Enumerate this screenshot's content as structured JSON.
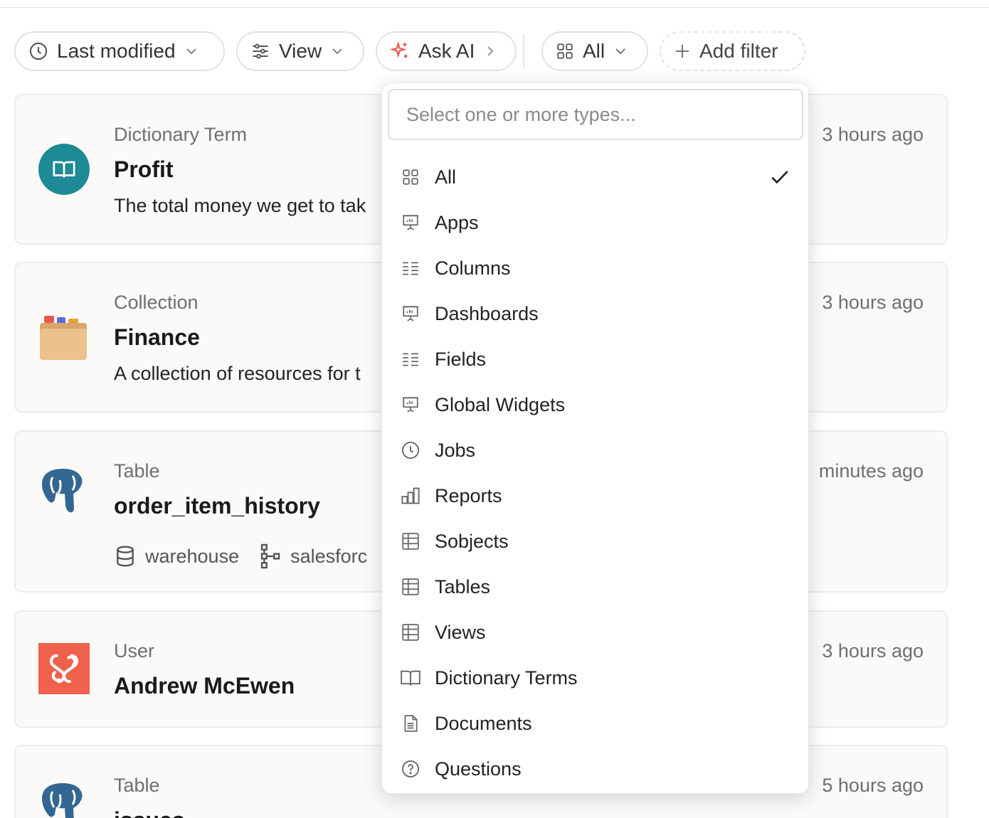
{
  "toolbar": {
    "sort_label": "Last modified",
    "view_label": "View",
    "ask_ai_label": "Ask AI",
    "type_label": "All",
    "add_filter_label": "Add filter"
  },
  "colors": {
    "ai_accent": "#e9574a",
    "dictionary_avatar": "#1e8a96",
    "user_avatar": "#f0614b",
    "postgres_blue": "#336791"
  },
  "results": [
    {
      "type": "Dictionary Term",
      "title": "Profit",
      "description": "The total money we get to tak",
      "time": "3 hours ago",
      "icon": "book-icon"
    },
    {
      "type": "Collection",
      "title": "Finance",
      "description": "A collection of resources for t",
      "time": "3 hours ago",
      "icon": "folder-icon"
    },
    {
      "type": "Table",
      "title": "order_item_history",
      "time": "minutes ago",
      "icon": "postgres-elephant-icon",
      "meta": [
        {
          "icon": "database-icon",
          "label": "warehouse"
        },
        {
          "icon": "schema-icon",
          "label": "salesforc"
        }
      ]
    },
    {
      "type": "User",
      "title": "Andrew McEwen",
      "time": "3 hours ago",
      "icon": "user-logo-icon"
    },
    {
      "type": "Table",
      "title": "issues",
      "time": "5 hours ago",
      "icon": "postgres-elephant-icon"
    }
  ],
  "type_filter": {
    "placeholder": "Select one or more types...",
    "options": [
      {
        "label": "All",
        "icon": "grid-icon",
        "selected": true
      },
      {
        "label": "Apps",
        "icon": "presentation-icon"
      },
      {
        "label": "Columns",
        "icon": "list-icon"
      },
      {
        "label": "Dashboards",
        "icon": "presentation-icon"
      },
      {
        "label": "Fields",
        "icon": "list-icon"
      },
      {
        "label": "Global Widgets",
        "icon": "presentation-icon"
      },
      {
        "label": "Jobs",
        "icon": "clock-icon"
      },
      {
        "label": "Reports",
        "icon": "bar-chart-icon"
      },
      {
        "label": "Sobjects",
        "icon": "table-icon"
      },
      {
        "label": "Tables",
        "icon": "table-icon"
      },
      {
        "label": "Views",
        "icon": "table-icon"
      },
      {
        "label": "Dictionary Terms",
        "icon": "book-icon"
      },
      {
        "label": "Documents",
        "icon": "document-icon"
      },
      {
        "label": "Questions",
        "icon": "question-icon"
      }
    ]
  }
}
